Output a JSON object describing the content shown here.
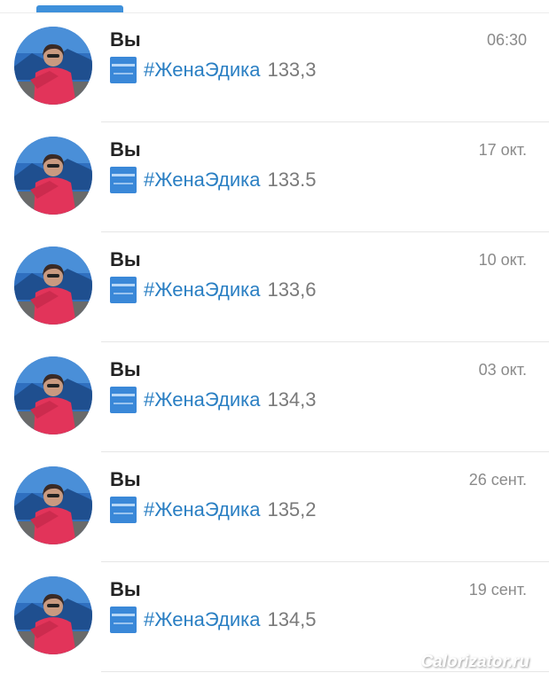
{
  "chats": [
    {
      "sender": "Вы",
      "time": "06:30",
      "hashtag": "#ЖенаЭдика",
      "weight": "133,3"
    },
    {
      "sender": "Вы",
      "time": "17 окт.",
      "hashtag": "#ЖенаЭдика",
      "weight": "133.5"
    },
    {
      "sender": "Вы",
      "time": "10 окт.",
      "hashtag": "#ЖенаЭдика",
      "weight": "133,6"
    },
    {
      "sender": "Вы",
      "time": "03 окт.",
      "hashtag": "#ЖенаЭдика",
      "weight": "134,3"
    },
    {
      "sender": "Вы",
      "time": "26 сент.",
      "hashtag": "#ЖенаЭдика",
      "weight": "135,2"
    },
    {
      "sender": "Вы",
      "time": "19 сент.",
      "hashtag": "#ЖенаЭдика",
      "weight": "134,5"
    }
  ],
  "watermark": "Calorizator.ru",
  "colors": {
    "accent": "#3e90db",
    "hashtag": "#2a7fc3",
    "jacket": "#e2345a"
  }
}
